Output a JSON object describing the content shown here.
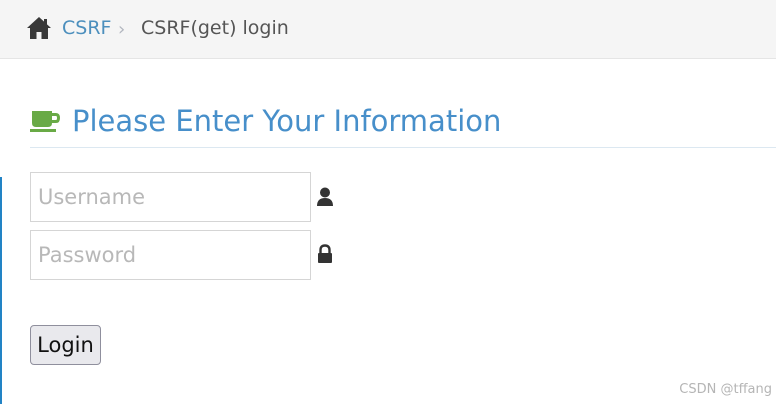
{
  "breadcrumb": {
    "home_icon": "home-icon",
    "items": [
      {
        "label": "CSRF"
      },
      {
        "label": "CSRF(get) login"
      }
    ],
    "separator": "›"
  },
  "form": {
    "title_icon": "coffee-cup-icon",
    "title": "Please Enter Your Information",
    "username": {
      "value": "",
      "placeholder": "Username",
      "icon": "user-icon"
    },
    "password": {
      "value": "",
      "placeholder": "Password",
      "icon": "lock-icon"
    },
    "submit_label": "Login"
  },
  "watermark": "CSDN @tffang",
  "colors": {
    "link": "#4c8fbd",
    "title": "#478fca",
    "accent_green": "#69aa46",
    "accent_bar": "#2283c5"
  }
}
